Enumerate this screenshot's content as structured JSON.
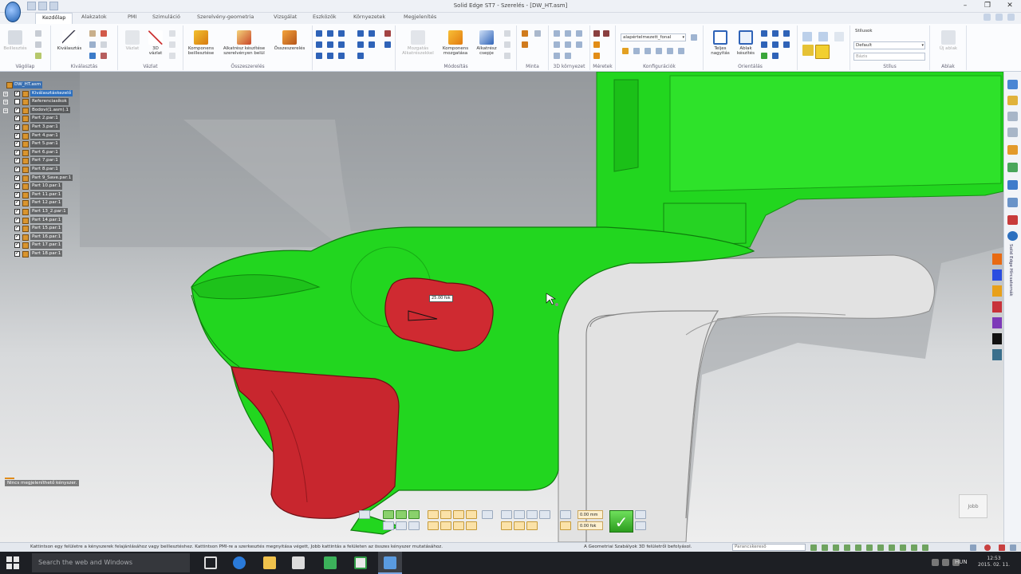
{
  "window": {
    "title": "Solid Edge ST7 - Szerelés - [DW_HT.asm]",
    "controls": [
      "–",
      "❐",
      "✕"
    ]
  },
  "ribbon": {
    "tabs": [
      "Kezdőlap",
      "Alakzatok",
      "PMI",
      "Szimuláció",
      "Szerelvény-geometria",
      "Vizsgálat",
      "Eszközök",
      "Környezetek",
      "Megjelenítés"
    ],
    "groups": [
      {
        "label": "Vágólap"
      },
      {
        "label": "Kiválasztás"
      },
      {
        "label": "Vázlat"
      },
      {
        "label": "Összeszerelés"
      },
      {
        "label": "Módosítás"
      },
      {
        "label": "Minta"
      },
      {
        "label": "3D környezet"
      },
      {
        "label": "Méretek"
      },
      {
        "label": "Konfigurációk"
      },
      {
        "label": "Orientálás"
      },
      {
        "label": "Stílus"
      },
      {
        "label": "Ablak"
      }
    ],
    "buttons": {
      "paste": "Beillesztés",
      "select": "Kiválasztás",
      "sketch": "Vázlat",
      "sketch3d": "3D vázlat",
      "insert_component": "Komponens beillesztése",
      "create_in_place": "Alkatrész készítése szerelvényen belül",
      "assemble": "Összeszerelés",
      "move_parts": "Mozgatás Alkatrészekkel",
      "move_component": "Komponens mozgatása",
      "part_copy": "Alkatrész csepje",
      "fit": "Teljes nagyítás",
      "window_create": "Ablak készítés",
      "new_window": "Új ablak"
    },
    "config_select": "alapértelmezett_fonal",
    "style_label": "Stílusok",
    "style_select": "Default",
    "style_field": "Bázis"
  },
  "pathfinder": {
    "root": "DW_HT.asm",
    "rows": [
      {
        "label": "Kiválasztáskezelő",
        "checked": true,
        "expander": "+"
      },
      {
        "label": "Referenciasíkok",
        "checked": false,
        "expander": "+"
      },
      {
        "label": "Bodovi(1.asm).1",
        "checked": true,
        "expander": "+"
      },
      {
        "label": "Part 2.par:1",
        "checked": true
      },
      {
        "label": "Part 3.par:1",
        "checked": true
      },
      {
        "label": "Part 4.par:1",
        "checked": true
      },
      {
        "label": "Part 5.par:1",
        "checked": true
      },
      {
        "label": "Part 6.par:1",
        "checked": true
      },
      {
        "label": "Part 7.par:1",
        "checked": true
      },
      {
        "label": "Part 8.par:1",
        "checked": true
      },
      {
        "label": "Part 9_Save.par:1",
        "checked": true
      },
      {
        "label": "Part 10.par:1",
        "checked": true
      },
      {
        "label": "Part 11.par:1",
        "checked": true
      },
      {
        "label": "Part 12.par:1",
        "checked": true
      },
      {
        "label": "Part 13_2.par:1",
        "checked": true
      },
      {
        "label": "Part 14.par:1",
        "checked": true
      },
      {
        "label": "Part 15.par:1",
        "checked": true
      },
      {
        "label": "Part 16.par:1",
        "checked": true
      },
      {
        "label": "Part 17.par:1",
        "checked": true
      },
      {
        "label": "Part 18.par:1",
        "checked": true
      }
    ]
  },
  "viewport": {
    "dimension_tag": "25.00 fok",
    "hint": "Nincs megjeleníthető kényszer.",
    "view_cube": "Jobb"
  },
  "command_bar": {
    "fields": [
      "0.00 mm",
      "0.00 fok"
    ],
    "accept": "✓"
  },
  "right_rail": {
    "label": "Solid Edge Hírcsatornák",
    "color_swatches": [
      "#e86a12",
      "#2b4de0",
      "#e8a01a",
      "#c8323a",
      "#7d3ab8",
      "#111111",
      "#3b6f8c"
    ]
  },
  "status_bar": {
    "message": "Kattintson egy felületre a kényszerek felajánlásához vagy beillesztéshez. Kattintson PMI-re a szerkesztés megnyitása végett, Jobb kattintás a felületen az összes kényszer mutatásához.",
    "message2": "A Geometriai Szabályok 3D felületről befolyásol.",
    "command_placeholder": "Parancskereső"
  },
  "taskbar": {
    "search_placeholder": "Search the web and Windows",
    "language": "HUN",
    "time": "12:53",
    "date": "2015. 02. 11."
  },
  "colors": {
    "green_part": "#22d61f",
    "red_part": "#c8262e",
    "ribbon_bg": "#fbfcfe",
    "accent": "#2c6fbf"
  }
}
